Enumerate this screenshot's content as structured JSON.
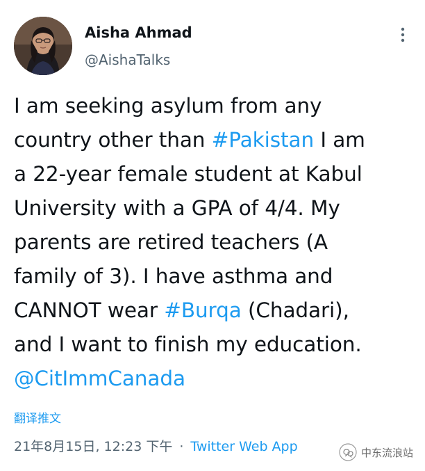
{
  "author": {
    "display_name": "Aisha Ahmad",
    "handle": "@AishaTalks"
  },
  "icons": {
    "more": "more-options-icon",
    "avatar": "profile-photo"
  },
  "tweet": {
    "lines": [
      [
        {
          "text": "I am seeking asylum from any",
          "link": false
        }
      ],
      [
        {
          "text": "country other than ",
          "link": false
        },
        {
          "text": "#Pakistan",
          "link": true
        },
        {
          "text": " I am",
          "link": false
        }
      ],
      [
        {
          "text": "a 22-year female student at Kabul",
          "link": false
        }
      ],
      [
        {
          "text": "University with a GPA of 4/4. My",
          "link": false
        }
      ],
      [
        {
          "text": "parents are retired teachers (A",
          "link": false
        }
      ],
      [
        {
          "text": "family of 3). I have asthma and",
          "link": false
        }
      ],
      [
        {
          "text": "CANNOT wear ",
          "link": false
        },
        {
          "text": "#Burqa",
          "link": true
        },
        {
          "text": " (Chadari),",
          "link": false
        }
      ],
      [
        {
          "text": "and I want to finish my education.",
          "link": false
        }
      ],
      [
        {
          "text": "@CitImmCanada",
          "link": true
        }
      ]
    ]
  },
  "translate_label": "翻译推文",
  "meta": {
    "timestamp": "21年8月15日, 12:23 下午",
    "separator": "·",
    "source": "Twitter Web App"
  },
  "watermark": {
    "text": "中东流浪站"
  },
  "colors": {
    "link": "#1d9bf0",
    "text": "#0f1419",
    "secondary": "#536471"
  }
}
